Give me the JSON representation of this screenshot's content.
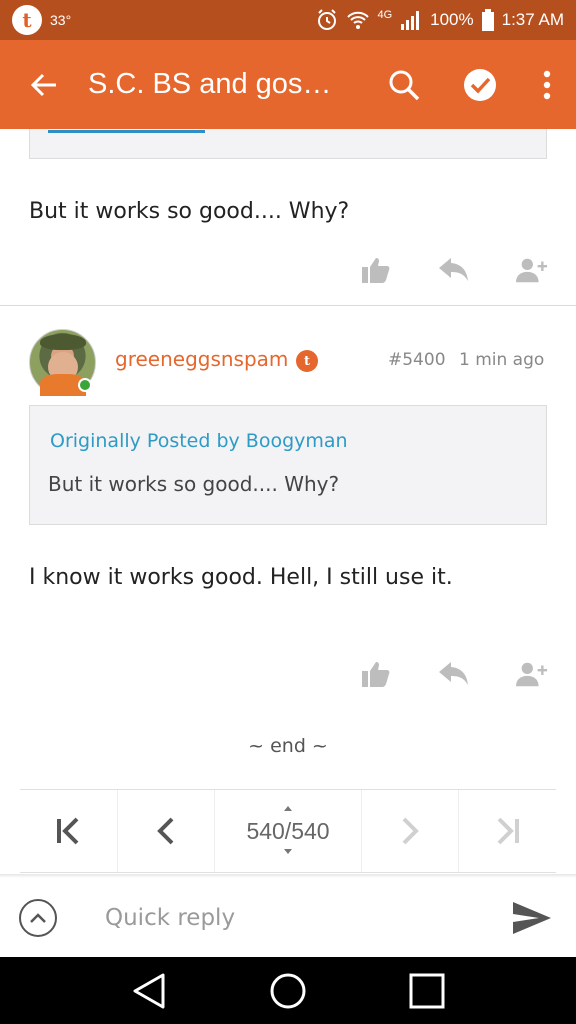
{
  "status_bar": {
    "temperature": "33°",
    "network": "4G",
    "battery": "100%",
    "time": "1:37 AM"
  },
  "app_bar": {
    "title": "S.C. BS and gos…",
    "icons": [
      "back-arrow-icon",
      "search-icon",
      "check-circle-icon",
      "more-vert-icon"
    ]
  },
  "posts": [
    {
      "text": "But it works so good.... Why?",
      "actions": [
        "thumbs-up-icon",
        "reply-icon",
        "add-user-icon"
      ]
    },
    {
      "username": "greeneggsnspam",
      "badge": "t",
      "number": "#5400",
      "time": "1 min ago",
      "quote": {
        "attribution": "Originally Posted by Boogyman",
        "text": "But it works so good.... Why?"
      },
      "text": "I know it works good. Hell, I still use it.",
      "actions": [
        "thumbs-up-icon",
        "reply-icon",
        "add-user-icon"
      ]
    }
  ],
  "end_marker": "~ end ~",
  "pager": {
    "page_label": "540/540"
  },
  "quick_reply": {
    "placeholder": "Quick reply"
  },
  "colors": {
    "status_bar": "#b64f1e",
    "app_bar": "#e5672d",
    "link": "#2d9bc5",
    "online": "#3ba53a"
  }
}
